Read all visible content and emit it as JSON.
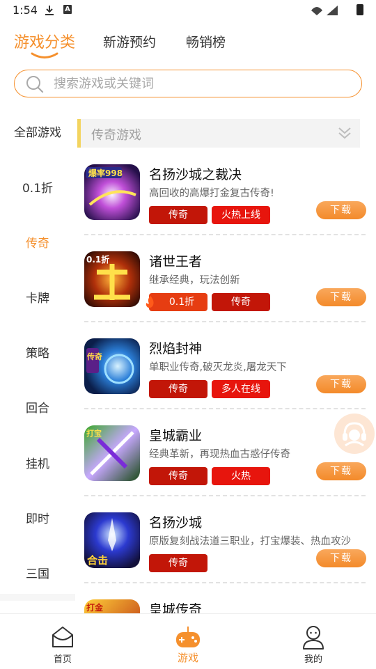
{
  "status_bar": {
    "time": "1:54"
  },
  "top_tabs": [
    {
      "label": "游戏分类",
      "active": true
    },
    {
      "label": "新游预约",
      "active": false
    },
    {
      "label": "畅销榜",
      "active": false
    }
  ],
  "search": {
    "placeholder": "搜索游戏或关键词"
  },
  "sidebar": {
    "items": [
      {
        "label": "全部游戏"
      },
      {
        "label": "0.1折"
      },
      {
        "label": "传奇"
      },
      {
        "label": "卡牌"
      },
      {
        "label": "策略"
      },
      {
        "label": "回合"
      },
      {
        "label": "挂机"
      },
      {
        "label": "即时"
      },
      {
        "label": "三国"
      }
    ],
    "active": "传奇"
  },
  "category_header": {
    "title": "传奇游戏"
  },
  "download_label": "下载",
  "games": [
    {
      "name": "名扬沙城之裁决",
      "desc": "高回收的高爆打金复古传奇!",
      "tags": [
        "传奇",
        "火热上线"
      ],
      "icon_text": "爆率998"
    },
    {
      "name": "诸世王者",
      "desc": "继承经典，玩法创新",
      "tags": [
        "0.1折",
        "传奇"
      ],
      "icon_text": "0.1折"
    },
    {
      "name": "烈焰封神",
      "desc": "单职业传奇,破灭龙炎,屠龙天下",
      "tags": [
        "传奇",
        "多人在线"
      ],
      "icon_text": "传奇"
    },
    {
      "name": "皇城霸业",
      "desc": "经典革新，再现热血古惑仔传奇",
      "tags": [
        "传奇",
        "火热"
      ],
      "icon_text": "打宝"
    },
    {
      "name": "名扬沙城",
      "desc": "原版复刻战法道三职业，打宝爆装、热血攻沙",
      "tags": [
        "传奇"
      ],
      "icon_text": "合击"
    },
    {
      "name": "皇城传奇",
      "desc": "",
      "tags": [],
      "icon_text": "打金"
    }
  ],
  "bottom_nav": [
    {
      "label": "首页",
      "icon": "home-icon"
    },
    {
      "label": "游戏",
      "icon": "gamepad-icon",
      "active": true
    },
    {
      "label": "我的",
      "icon": "user-icon"
    }
  ],
  "colors": {
    "accent": "#f5902d",
    "tag_red": "#c21608",
    "tag_hot": "#e7150d"
  }
}
